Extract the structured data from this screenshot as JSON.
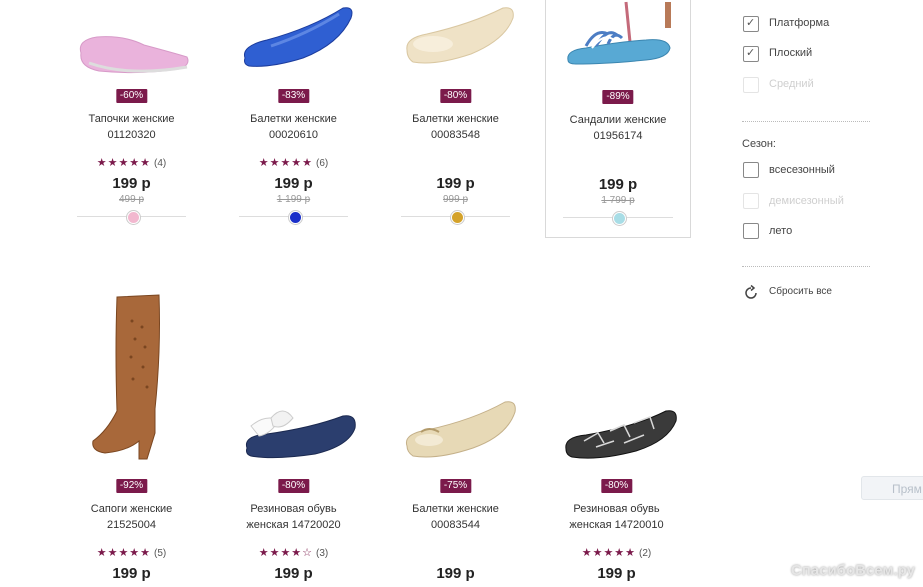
{
  "products": [
    {
      "badge": "-60%",
      "name1": "Тапочки женские",
      "name2": "01120320",
      "stars": "★★★★★",
      "count": "(4)",
      "price": "199 р",
      "old": "499 р",
      "swatch": "#f2b8cf"
    },
    {
      "badge": "-83%",
      "name1": "Балетки женские",
      "name2": "00020610",
      "stars": "★★★★★",
      "count": "(6)",
      "price": "199 р",
      "old": "1 199 р",
      "swatch": "#1a2fc9"
    },
    {
      "badge": "-80%",
      "name1": "Балетки женские",
      "name2": "00083548",
      "stars": "",
      "count": "",
      "price": "199 р",
      "old": "999 р",
      "swatch": "#d4a22a"
    },
    {
      "badge": "-89%",
      "name1": "Сандалии женские",
      "name2": "01956174",
      "stars": "",
      "count": "",
      "price": "199 р",
      "old": "1 799 р",
      "swatch": "#a8dde6"
    },
    {
      "badge": "-92%",
      "name1": "Сапоги женские",
      "name2": "21525004",
      "stars": "★★★★★",
      "count": "(5)",
      "price": "199 р",
      "old": "",
      "swatch": ""
    },
    {
      "badge": "-80%",
      "name1": "Резиновая обувь",
      "name2": "женская 14720020",
      "stars": "★★★★☆",
      "count": "(3)",
      "price": "199 р",
      "old": "",
      "swatch": ""
    },
    {
      "badge": "-75%",
      "name1": "Балетки женские",
      "name2": "00083544",
      "stars": "",
      "count": "",
      "price": "199 р",
      "old": "",
      "swatch": ""
    },
    {
      "badge": "-80%",
      "name1": "Резиновая обувь",
      "name2": "женская 14720010",
      "stars": "★★★★★",
      "count": "(2)",
      "price": "199 р",
      "old": "",
      "swatch": ""
    }
  ],
  "filters": {
    "heel": [
      {
        "label": "Платформа",
        "checked": true,
        "disabled": false
      },
      {
        "label": "Плоский",
        "checked": true,
        "disabled": false
      },
      {
        "label": "Средний",
        "checked": false,
        "disabled": true
      }
    ],
    "season_title": "Сезон:",
    "season": [
      {
        "label": "всесезонный",
        "checked": false,
        "disabled": false
      },
      {
        "label": "демисезонный",
        "checked": false,
        "disabled": true
      },
      {
        "label": "лето",
        "checked": false,
        "disabled": false
      }
    ],
    "reset_label": "Сбросить все"
  },
  "side_button_label": "Прям",
  "watermark": "СпасибоВсем.ру",
  "colors": {
    "accent": "#7b1a4b"
  }
}
